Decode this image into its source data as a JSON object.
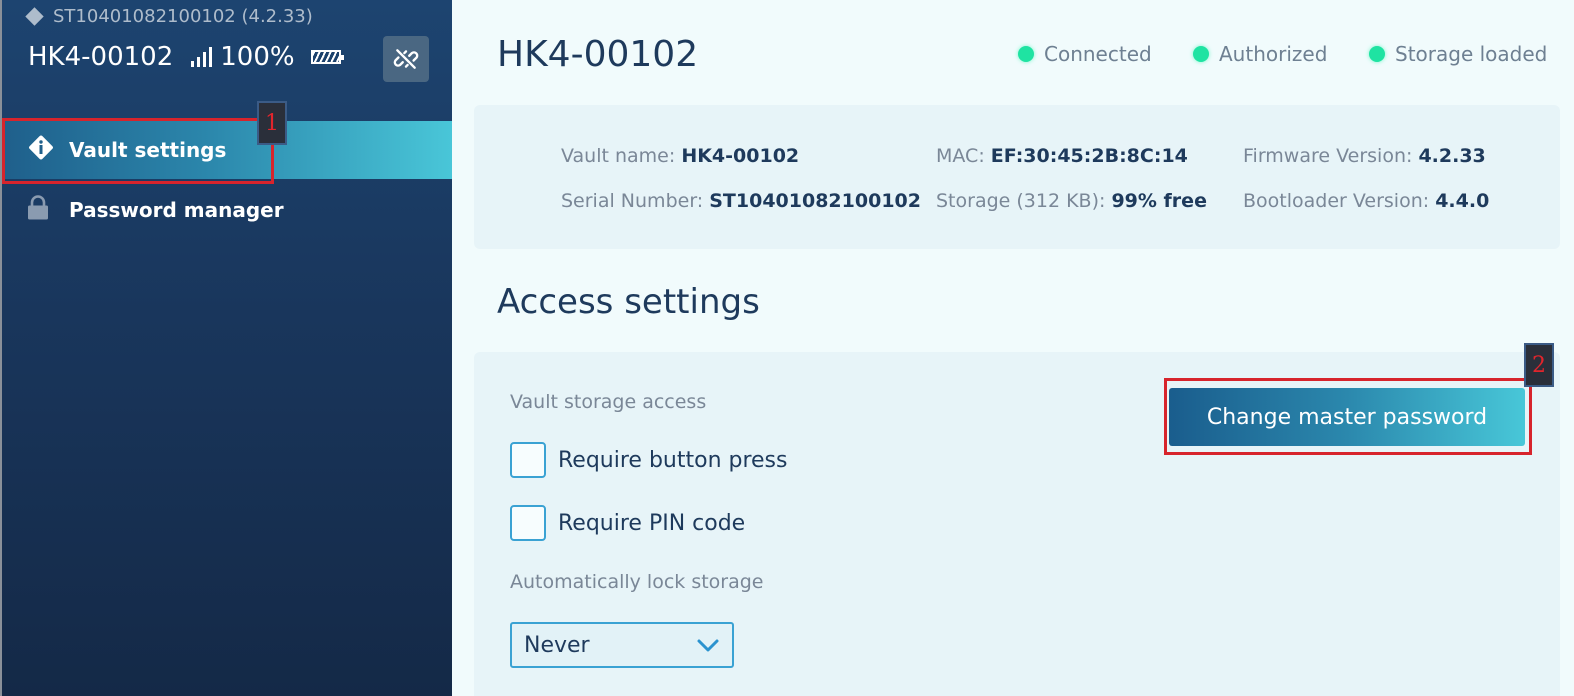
{
  "sidebar": {
    "serial_line": "ST10401082100102 (4.2.33)",
    "device_name": "HK4-00102",
    "battery_percent": "100%",
    "nav_items": [
      {
        "label": "Vault settings",
        "icon": "diamond-info-icon",
        "active": true
      },
      {
        "label": "Password manager",
        "icon": "lock-icon",
        "active": false
      }
    ]
  },
  "header": {
    "title": "HK4-00102",
    "statuses": [
      {
        "label": "Connected",
        "color": "#1fe3a2"
      },
      {
        "label": "Authorized",
        "color": "#1fe3a2"
      },
      {
        "label": "Storage loaded",
        "color": "#1fe3a2"
      }
    ]
  },
  "info": {
    "vault_name_label": "Vault name:",
    "vault_name_value": "HK4-00102",
    "serial_label": "Serial Number:",
    "serial_value": "ST10401082100102",
    "mac_label": "MAC:",
    "mac_value": "EF:30:45:2B:8C:14",
    "storage_label": "Storage (312 KB):",
    "storage_value": "99% free",
    "firmware_label": "Firmware Version:",
    "firmware_value": "4.2.33",
    "bootloader_label": "Bootloader Version:",
    "bootloader_value": "4.4.0"
  },
  "access": {
    "section_title": "Access settings",
    "storage_access_label": "Vault storage access",
    "require_button_label": "Require button press",
    "require_button_checked": false,
    "require_pin_label": "Require PIN code",
    "require_pin_checked": false,
    "auto_lock_label": "Automatically lock storage",
    "auto_lock_value": "Never",
    "change_password_label": "Change master password"
  },
  "annotations": [
    {
      "label": "1"
    },
    {
      "label": "2"
    }
  ],
  "colors": {
    "accent": "#2b88ad",
    "status_ok": "#1fe3a2",
    "annotation": "#d7242c"
  }
}
